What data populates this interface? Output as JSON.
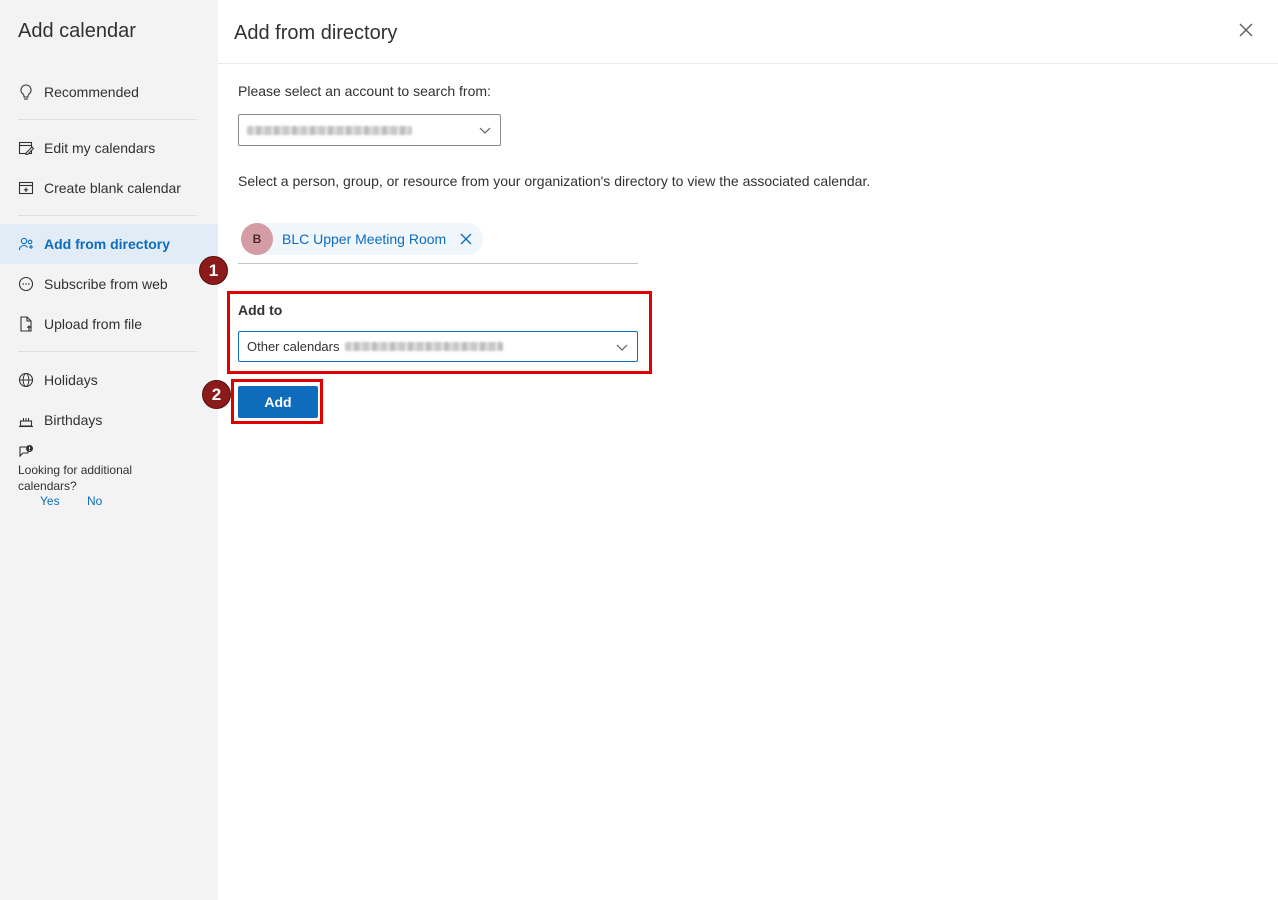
{
  "sidebar": {
    "title": "Add calendar",
    "items": [
      {
        "label": "Recommended",
        "icon": "lightbulb-icon"
      },
      {
        "label": "Edit my calendars",
        "icon": "edit-calendar-icon"
      },
      {
        "label": "Create blank calendar",
        "icon": "calendar-add-icon"
      },
      {
        "label": "Add from directory",
        "icon": "people-search-icon",
        "active": true
      },
      {
        "label": "Subscribe from web",
        "icon": "globe-link-icon"
      },
      {
        "label": "Upload from file",
        "icon": "document-upload-icon"
      },
      {
        "label": "Holidays",
        "icon": "globe-icon"
      },
      {
        "label": "Birthdays",
        "icon": "cake-icon"
      }
    ],
    "feedback": {
      "text": "Looking for additional calendars?",
      "yes": "Yes",
      "no": "No"
    }
  },
  "main": {
    "title": "Add from directory",
    "account_label": "Please select an account to search from:",
    "help_text": "Select a person, group, or resource from your organization's directory to view the associated calendar.",
    "selected_person": {
      "initial": "B",
      "name": "BLC Upper Meeting Room"
    },
    "add_to_label": "Add to",
    "add_to_value": "Other calendars",
    "add_button": "Add"
  },
  "annotations": {
    "step1": "1",
    "step2": "2"
  },
  "colors": {
    "accent": "#0f6cbd",
    "highlight": "#e00000",
    "badge": "#8b1a1a",
    "sidebar_bg": "#f3f3f3",
    "avatar": "#d69ca5"
  }
}
